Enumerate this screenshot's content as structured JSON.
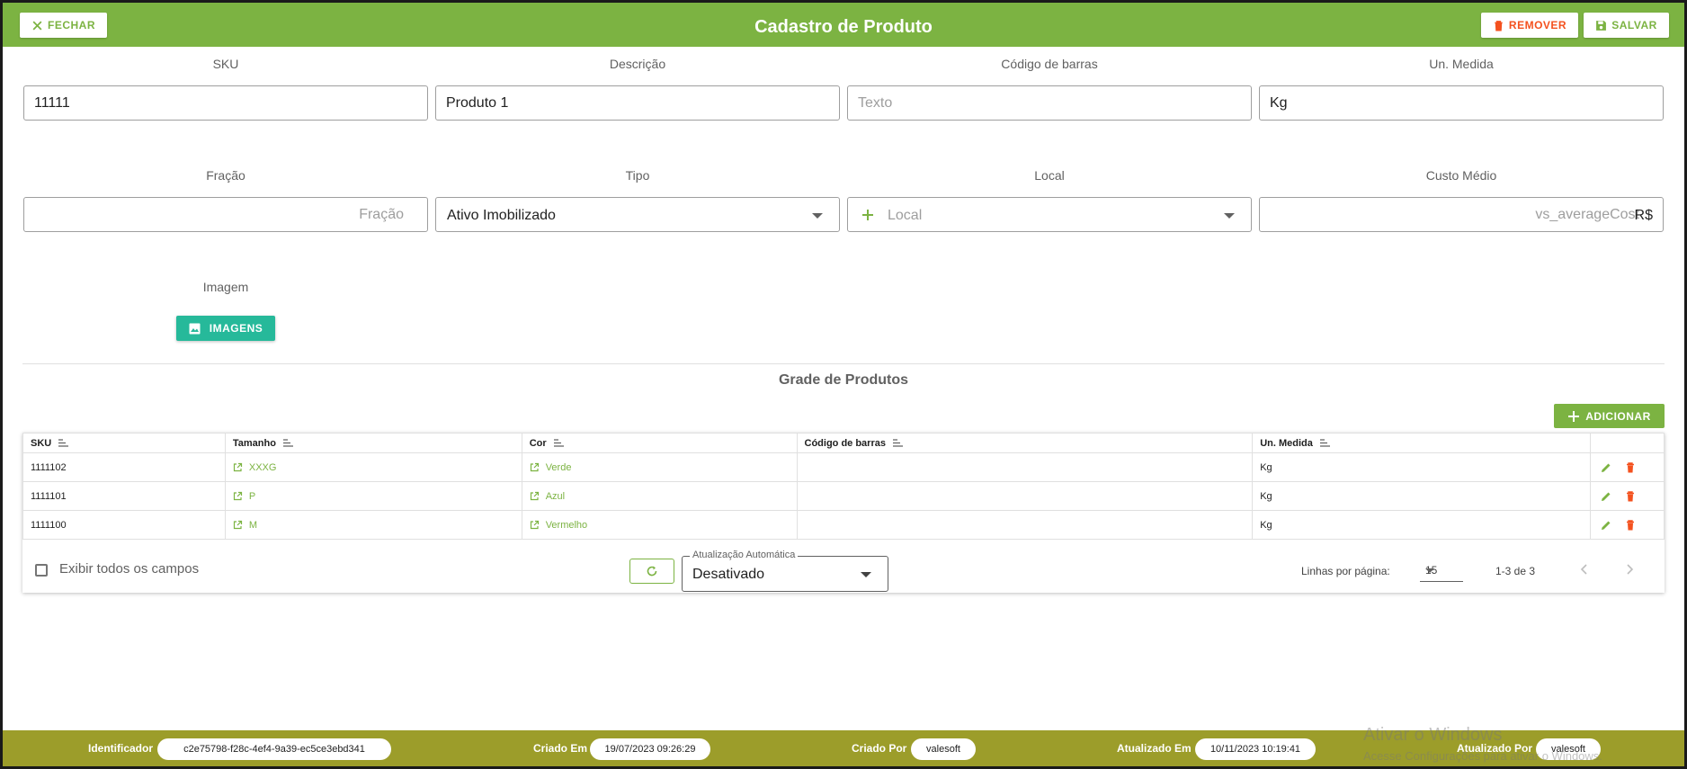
{
  "header": {
    "title": "Cadastro de Produto",
    "close_label": "FECHAR",
    "remove_label": "REMOVER",
    "save_label": "SALVAR",
    "colors": {
      "primary": "#7cb342",
      "danger": "#f4511e"
    }
  },
  "form": {
    "sku": {
      "label": "SKU",
      "value": "11111"
    },
    "descricao": {
      "label": "Descrição",
      "value": "Produto 1"
    },
    "codigo_barras": {
      "label": "Código de barras",
      "placeholder": "Texto"
    },
    "un_medida": {
      "label": "Un. Medida",
      "value": "Kg"
    },
    "fracao": {
      "label": "Fração",
      "placeholder": "Fração"
    },
    "tipo": {
      "label": "Tipo",
      "value": "Ativo Imobilizado"
    },
    "local": {
      "label": "Local",
      "placeholder": "Local"
    },
    "custo_medio": {
      "label": "Custo Médio",
      "placeholder": "vs_averageCost",
      "suffix": "R$"
    },
    "imagem": {
      "label": "Imagem",
      "button_label": "IMAGENS"
    }
  },
  "grade": {
    "title": "Grade de Produtos",
    "add_label": "ADICIONAR",
    "columns": [
      "SKU",
      "Tamanho",
      "Cor",
      "Código de barras",
      "Un. Medida"
    ],
    "rows": [
      {
        "sku": "1111102",
        "tamanho": "XXXG",
        "cor": "Verde",
        "codigo": "",
        "unidade": "Kg"
      },
      {
        "sku": "1111101",
        "tamanho": "P",
        "cor": "Azul",
        "codigo": "",
        "unidade": "Kg"
      },
      {
        "sku": "1111100",
        "tamanho": "M",
        "cor": "Vermelho",
        "codigo": "",
        "unidade": "Kg"
      }
    ],
    "footer": {
      "show_all_label": "Exibir todos os campos",
      "auto_update_label": "Atualização Automática",
      "auto_update_value": "Desativado",
      "rows_per_page_label": "Linhas por página:",
      "rows_per_page_value": "15",
      "range": "1-3 de 3"
    }
  },
  "footer": {
    "identificador_label": "Identificador",
    "identificador_value": "c2e75798-f28c-4ef4-9a39-ec5ce3ebd341",
    "criado_em_label": "Criado Em",
    "criado_em_value": "19/07/2023 09:26:29",
    "criado_por_label": "Criado Por",
    "criado_por_value": "valesoft",
    "atualizado_em_label": "Atualizado Em",
    "atualizado_em_value": "10/11/2023 10:19:41",
    "atualizado_por_label": "Atualizado Por",
    "atualizado_por_value": "valesoft"
  },
  "watermark": {
    "line1": "Ativar o Windows",
    "line2": "Acesse Configurações para ativar o Windows."
  }
}
